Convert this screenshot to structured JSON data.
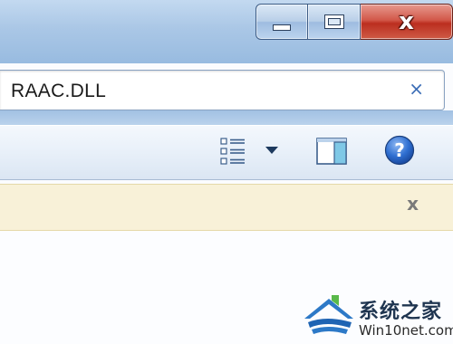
{
  "window": {
    "caption_buttons": {
      "minimize_icon": "minimize-icon",
      "maximize_icon": "maximize-icon",
      "close_glyph": "x"
    }
  },
  "search": {
    "value": "RAAC.DLL",
    "clear_glyph": "×"
  },
  "toolbar": {
    "views_icon": "views-details-icon",
    "views_dropdown_icon": "chevron-down-icon",
    "preview_pane_icon": "preview-pane-icon",
    "help_icon": "help-icon",
    "help_glyph": "?"
  },
  "infobar": {
    "close_glyph": "x"
  },
  "watermark": {
    "title": "系统之家",
    "url": "Win10net.com"
  },
  "colors": {
    "frame": "#aac7e6",
    "close_red": "#c7412f",
    "clear_blue": "#3b6db6",
    "infobar_bg": "#f8f1d8",
    "help_blue": "#2f6fd1"
  }
}
